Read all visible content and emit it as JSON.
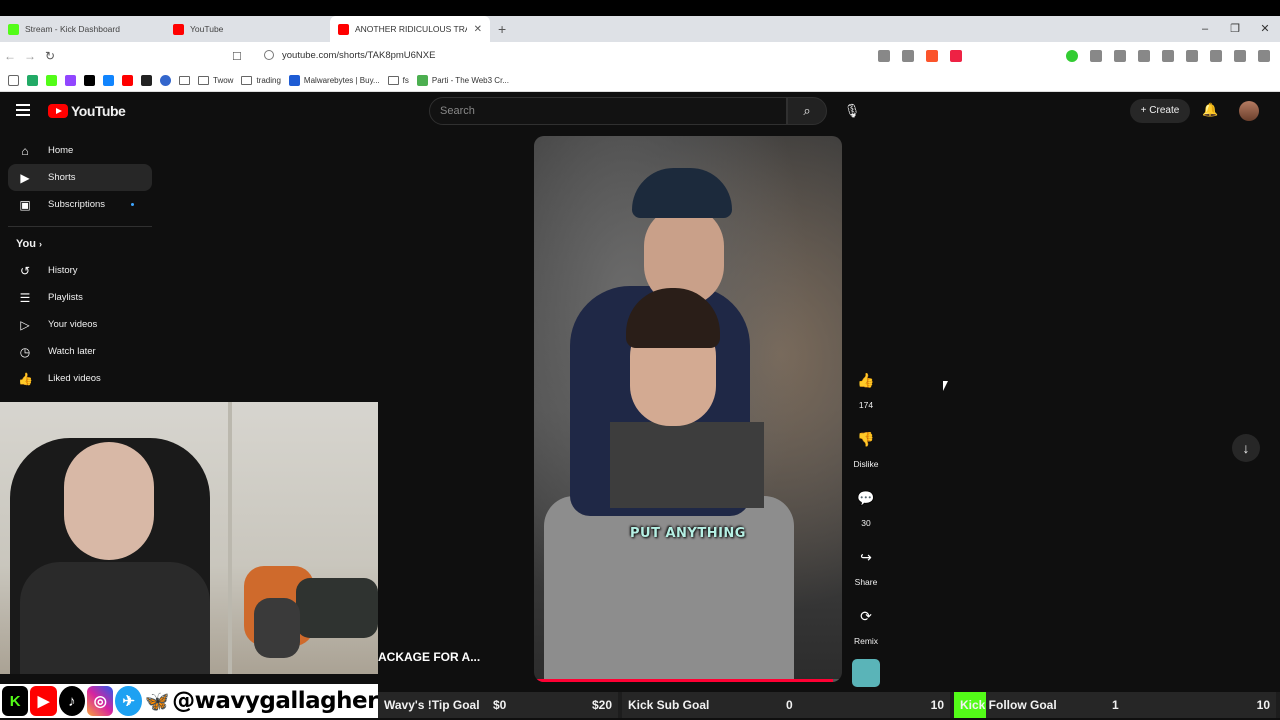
{
  "browser": {
    "tabs": [
      {
        "title": "Stream - Kick Dashboard",
        "color": "#53fc18"
      },
      {
        "title": "YouTube",
        "color": "#ff0000"
      },
      {
        "title": "ANOTHER RIDICULOUS TRAD",
        "color": "#ff0000",
        "active": true
      }
    ],
    "url": "youtube.com/shorts/TAK8pmU6NXE",
    "bookmarks": [
      "Twow",
      "trading",
      "Malwarebytes | Buy...",
      "fs",
      "Parti - The Web3 Cr..."
    ]
  },
  "header": {
    "logo": "YouTube",
    "search_placeholder": "Search",
    "create_label": "Create"
  },
  "sidebar": {
    "items_top": [
      {
        "label": "Home",
        "icon": "home-icon"
      },
      {
        "label": "Shorts",
        "icon": "shorts-icon",
        "active": true
      },
      {
        "label": "Subscriptions",
        "icon": "subscriptions-icon"
      }
    ],
    "you_heading": "You",
    "items_you": [
      {
        "label": "History",
        "icon": "history-icon"
      },
      {
        "label": "Playlists",
        "icon": "playlists-icon"
      },
      {
        "label": "Your videos",
        "icon": "your-videos-icon"
      },
      {
        "label": "Watch later",
        "icon": "watch-later-icon"
      },
      {
        "label": "Liked videos",
        "icon": "liked-videos-icon"
      }
    ]
  },
  "short": {
    "caption": "PUT ANYTHING",
    "title_fragment": "ACKAGE FOR A...",
    "progress": 0.97,
    "likes": "174",
    "dislike_label": "Dislike",
    "comments": "30",
    "share_label": "Share",
    "remix_label": "Remix"
  },
  "social": {
    "handle": "@wavygallagher"
  },
  "goals": [
    {
      "name": "Wavy's !Tip Goal",
      "current": "$0",
      "max": "$20",
      "progress": 0
    },
    {
      "name": "Kick Sub Goal",
      "current": "0",
      "max": "10",
      "progress": 0
    },
    {
      "name": "Kick Follow Goal",
      "current": "1",
      "max": "10",
      "progress": 0.1
    }
  ]
}
